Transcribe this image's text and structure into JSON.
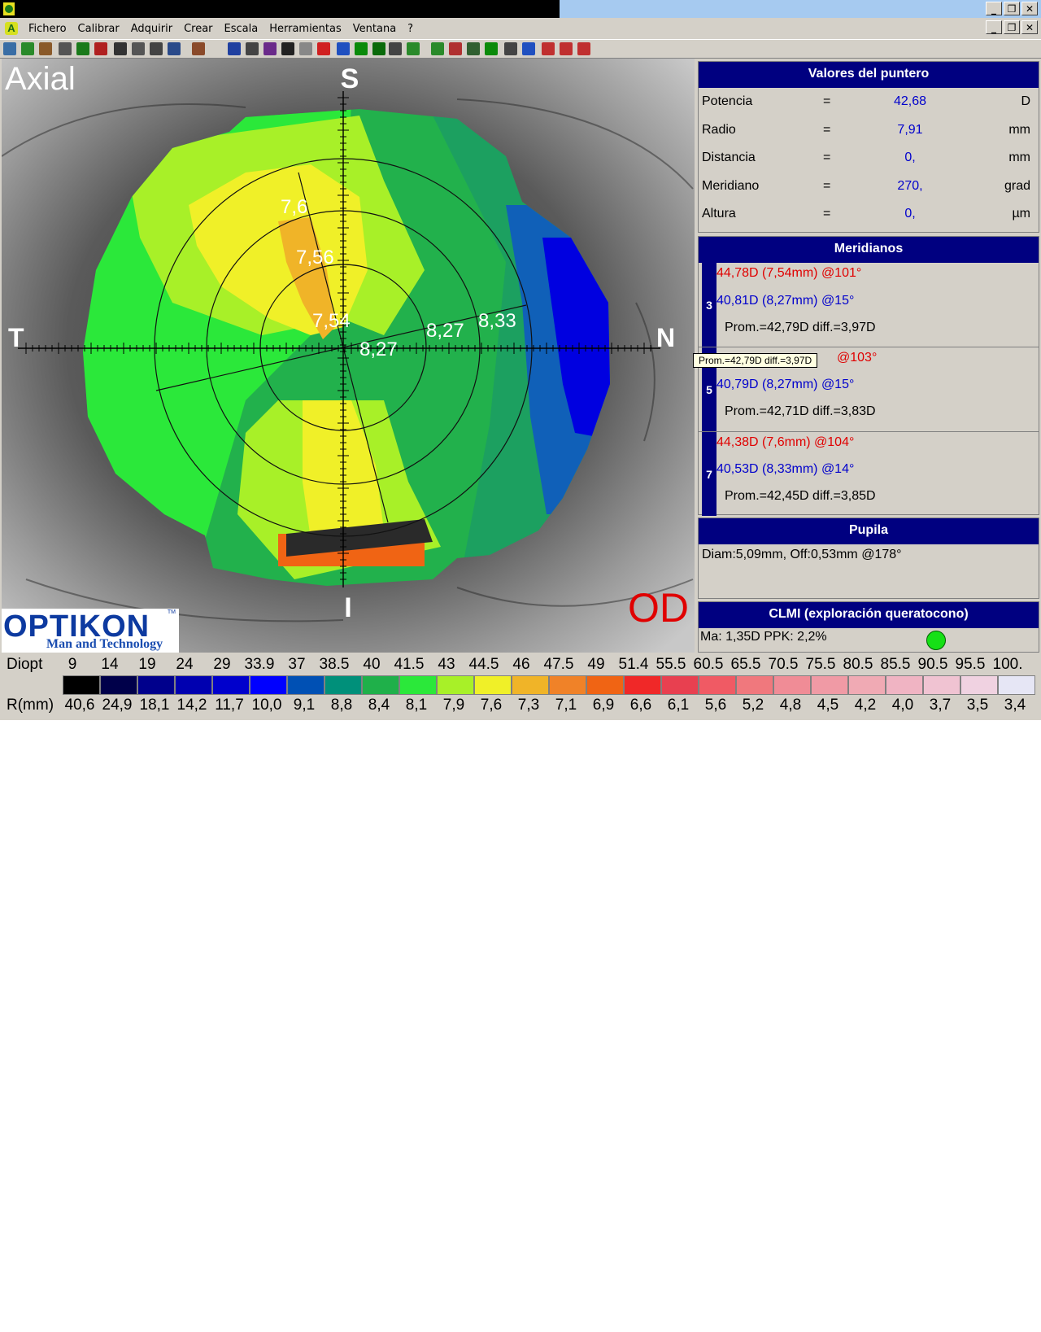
{
  "window": {
    "controls": [
      "_",
      "❐",
      "✕"
    ]
  },
  "menu": {
    "items": [
      "Fichero",
      "Calibrar",
      "Adquirir",
      "Crear",
      "Escala",
      "Herramientas",
      "Ventana",
      "?"
    ]
  },
  "toolbar": {
    "icons": [
      "save-map-icon",
      "hand-icon",
      "pin-icon",
      "tools-icon",
      "globe-icon",
      "r-icon",
      "disk-icon",
      "disk-icon",
      "print-icon",
      "monitor-icon",
      "camera-icon",
      "list-icon",
      "close-icon",
      "book-icon",
      "eye-icon",
      "grid-icon",
      "target-icon",
      "circle-icon",
      "a-icon",
      "g-icon",
      "pointer-icon",
      "w-icon",
      "table-icon",
      "chart-icon",
      "scissors-icon",
      "eye-icon",
      "compare-icon",
      "rx-icon",
      "bars-icon",
      "bars-icon",
      "bars-icon"
    ]
  },
  "map": {
    "mode_label": "Axial",
    "axis_top": "S",
    "axis_bottom": "I",
    "axis_left": "T",
    "axis_right": "N",
    "eye_label": "OD",
    "value_labels": [
      "7,6",
      "7,56",
      "7,54",
      "8,27",
      "8,33",
      "8,27"
    ],
    "brand": "OPTIKON",
    "brand_tm": "TM",
    "brand_tagline": "Man and Technology"
  },
  "pointer": {
    "title": "Valores del puntero",
    "rows": [
      {
        "label": "Potencia",
        "eq": "=",
        "value": "42,68",
        "unit": "D"
      },
      {
        "label": "Radio",
        "eq": "=",
        "value": "7,91",
        "unit": "mm"
      },
      {
        "label": "Distancia",
        "eq": "=",
        "value": "0,",
        "unit": "mm"
      },
      {
        "label": "Meridiano",
        "eq": "=",
        "value": "270,",
        "unit": "grad"
      },
      {
        "label": "Altura",
        "eq": "=",
        "value": "0,",
        "unit": "µm"
      }
    ]
  },
  "meridianos": {
    "title": "Meridianos",
    "blocks": [
      {
        "num": "3",
        "red": "44,78D (7,54mm) @101°",
        "blue": "40,81D (8,27mm) @15°",
        "prom": "Prom.=42,79D  diff.=3,97D"
      },
      {
        "num": "5",
        "red": "@103°",
        "blue": "40,79D (8,27mm) @15°",
        "prom": "Prom.=42,71D  diff.=3,83D"
      },
      {
        "num": "7",
        "red": "44,38D (7,6mm) @104°",
        "blue": "40,53D (8,33mm) @14°",
        "prom": "Prom.=42,45D  diff.=3,85D"
      }
    ],
    "tooltip": "Prom.=42,79D  diff.=3,97D"
  },
  "pupila": {
    "title": "Pupila",
    "text": "Diam:5,09mm, Off:0,53mm @178°"
  },
  "clmi": {
    "title": "CLMI (exploración queratocono)",
    "text": "Ma: 1,35D   PPK: 2,2%",
    "status_color": "#16e016"
  },
  "scale": {
    "diopt_label": "Diopt",
    "r_label": "R(mm)",
    "diopt_values": [
      "9",
      "14",
      "19",
      "24",
      "29",
      "33.9",
      "37",
      "38.5",
      "40",
      "41.5",
      "43",
      "44.5",
      "46",
      "47.5",
      "49",
      "51.4",
      "55.5",
      "60.5",
      "65.5",
      "70.5",
      "75.5",
      "80.5",
      "85.5",
      "90.5",
      "95.5",
      "100."
    ],
    "r_values": [
      "40,6",
      "24,9",
      "18,1",
      "14,2",
      "11,7",
      "10,0",
      "9,1",
      "8,8",
      "8,4",
      "8,1",
      "7,9",
      "7,6",
      "7,3",
      "7,1",
      "6,9",
      "6,6",
      "6,1",
      "5,6",
      "5,2",
      "4,8",
      "4,5",
      "4,2",
      "4,0",
      "3,7",
      "3,5",
      "3,4"
    ],
    "colors": [
      "#000000",
      "#00004a",
      "#00008c",
      "#0000b0",
      "#0000cc",
      "#0000ff",
      "#0050b4",
      "#00907a",
      "#1fb04a",
      "#2be83a",
      "#a8f028",
      "#f0f028",
      "#f0b428",
      "#f08228",
      "#f06414",
      "#f02828",
      "#e84050",
      "#f05a64",
      "#f0787d",
      "#f08c96",
      "#f09aa5",
      "#f0aab4",
      "#f0b4c3",
      "#f0c3d2",
      "#f0d2e1",
      "#e6e6f5"
    ]
  }
}
